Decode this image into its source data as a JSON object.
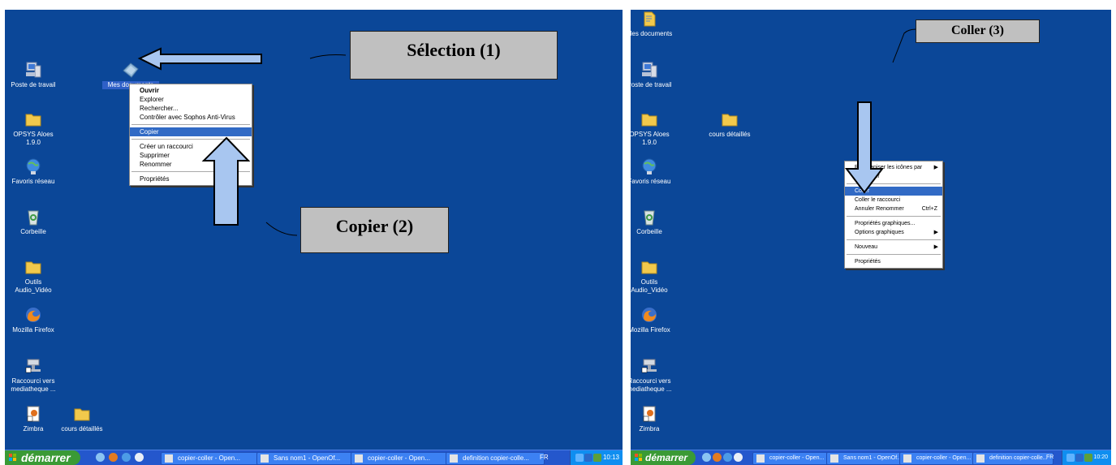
{
  "screen1": {
    "icons": [
      {
        "name": "poste-de-travail-icon",
        "label": "Poste de travail"
      },
      {
        "name": "mes-documents-icon",
        "label": "Mes documents"
      },
      {
        "name": "opsys-aloes-icon",
        "label": "OPSYS Aloes\n1.9.0"
      },
      {
        "name": "favoris-reseau-icon",
        "label": "Favoris réseau"
      },
      {
        "name": "corbeille-icon",
        "label": "Corbeille"
      },
      {
        "name": "outils-audio-video-icon",
        "label": "Outils\nAudio_Vidéo"
      },
      {
        "name": "mozilla-firefox-icon",
        "label": "Mozilla Firefox"
      },
      {
        "name": "raccourci-mediatheque-icon",
        "label": "Raccourci vers\nmediatheque ..."
      },
      {
        "name": "zimbra-icon",
        "label": "Zimbra"
      },
      {
        "name": "cours-details-icon",
        "label": "cours détaillés"
      }
    ],
    "menu": {
      "ouvrir": "Ouvrir",
      "explorer": "Explorer",
      "rechercher": "Rechercher...",
      "sophos": "Contrôler avec Sophos Anti-Virus",
      "copier": "Copier",
      "creer_raccourci": "Créer un raccourci",
      "supprimer": "Supprimer",
      "renommer": "Renommer",
      "proprietes": "Propriétés"
    },
    "callout_selection": "Sélection (1)",
    "callout_copier": "Copier (2)",
    "taskbar": {
      "start": "démarrer",
      "tasks": [
        "copier-coller - Open...",
        "Sans nom1 - OpenOf...",
        "copier-coller - Open...",
        "definition copier-colle..."
      ],
      "lang": "FR",
      "clock": "10:13"
    }
  },
  "screen2": {
    "icons": [
      {
        "name": "mes-documents-icon",
        "label": "Mes documents"
      },
      {
        "name": "poste-de-travail-icon",
        "label": "Poste de travail"
      },
      {
        "name": "opsys-aloes-icon",
        "label": "OPSYS Aloes\n1.9.0"
      },
      {
        "name": "cours-details-icon",
        "label": "cours détaillés"
      },
      {
        "name": "favoris-reseau-icon",
        "label": "Favoris réseau"
      },
      {
        "name": "corbeille-icon",
        "label": "Corbeille"
      },
      {
        "name": "outils-audio-video-icon",
        "label": "Outils\nAudio_Vidéo"
      },
      {
        "name": "mozilla-firefox-icon",
        "label": "Mozilla Firefox"
      },
      {
        "name": "raccourci-mediatheque-icon",
        "label": "Raccourci vers\nmediatheque ..."
      },
      {
        "name": "zimbra-icon",
        "label": "Zimbra"
      }
    ],
    "menu": {
      "reorganiser": "Réorganiser les icônes par",
      "actualiser": "Actualiser",
      "coller": "Coller",
      "coller_raccourci": "Coller le raccourci",
      "annuler": "Annuler Renommer",
      "annuler_shortcut": "Ctrl+Z",
      "proprietes_graphiques": "Propriétés graphiques...",
      "options_graphiques": "Options graphiques",
      "nouveau": "Nouveau",
      "proprietes": "Propriétés"
    },
    "callout_coller": "Coller (3)",
    "taskbar": {
      "start": "démarrer",
      "tasks": [
        "copier-coller - Open...",
        "Sans nom1 - OpenOf...",
        "copier-coller - Open...",
        "definition copier-colle..."
      ],
      "lang": "FR",
      "clock": "10:20"
    }
  },
  "colors": {
    "desktop": "#0b4798",
    "callout": "#c0c0c0",
    "arrow": "#a8c6f0",
    "menu_highlight": "#316ac5"
  }
}
